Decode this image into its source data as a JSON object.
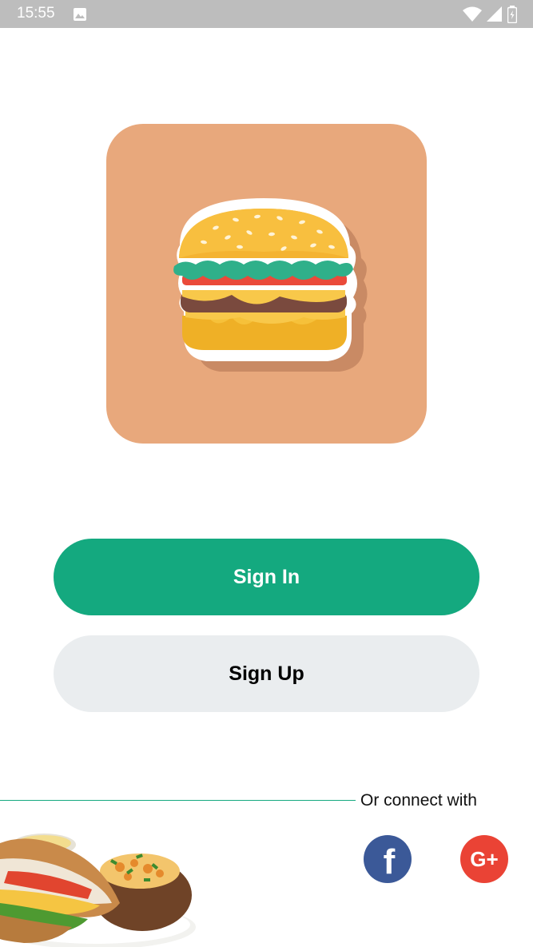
{
  "status_bar": {
    "time": "15:55"
  },
  "auth": {
    "sign_in_label": "Sign In",
    "sign_up_label": "Sign Up"
  },
  "social": {
    "connect_label": "Or connect with",
    "facebook_glyph": "f",
    "google_glyph": "G+"
  },
  "colors": {
    "primary": "#14a97f",
    "logo_bg": "#e8a87c",
    "secondary_button": "#eaedef",
    "facebook": "#3b5998",
    "google": "#ea4335"
  },
  "icons": [
    "image-icon",
    "wifi-icon",
    "signal-icon",
    "battery-icon",
    "burger-logo-icon",
    "facebook-icon",
    "google-plus-icon"
  ]
}
